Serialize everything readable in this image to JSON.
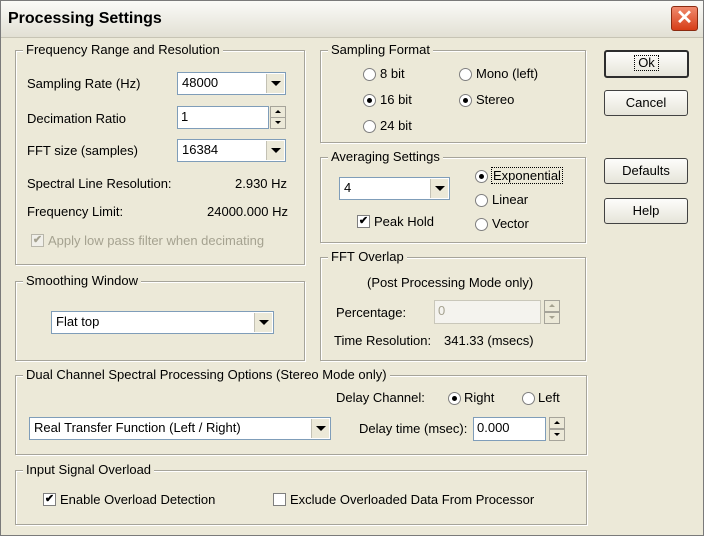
{
  "dialog": {
    "title": "Processing Settings",
    "close_glyph": "✕"
  },
  "freq": {
    "title": "Frequency Range and Resolution",
    "sampling_rate_label": "Sampling Rate (Hz)",
    "sampling_rate_value": "48000",
    "decimation_label": "Decimation Ratio",
    "decimation_value": "1",
    "fft_size_label": "FFT size (samples)",
    "fft_size_value": "16384",
    "spectral_res_label": "Spectral Line Resolution:",
    "spectral_res_value": "2.930 Hz",
    "freq_limit_label": "Frequency Limit:",
    "freq_limit_value": "24000.000 Hz",
    "lowpass_label": "Apply low pass filter when decimating",
    "lowpass_checked": true,
    "lowpass_check_glyph": "✔"
  },
  "sampling": {
    "title": "Sampling Format",
    "bits8": "8 bit",
    "bits16": "16 bit",
    "bits24": "24 bit",
    "mono": "Mono (left)",
    "stereo": "Stereo",
    "selected_bits": "16 bit",
    "selected_channels": "Stereo"
  },
  "averaging": {
    "title": "Averaging Settings",
    "count_value": "4",
    "exponential": "Exponential",
    "linear": "Linear",
    "vector": "Vector",
    "selected": "Exponential",
    "peak_hold_label": "Peak Hold",
    "peak_hold_checked": true,
    "check_glyph": "✔"
  },
  "overlap": {
    "title": "FFT Overlap",
    "note": "(Post Processing Mode only)",
    "percentage_label": "Percentage:",
    "percentage_value": "0",
    "time_res_label": "Time Resolution:",
    "time_res_value": "341.33 (msecs)"
  },
  "smoothing": {
    "title": "Smoothing Window",
    "value": "Flat top"
  },
  "dual": {
    "title": "Dual Channel Spectral Processing Options (Stereo Mode only)",
    "delay_channel_label": "Delay Channel:",
    "right": "Right",
    "left": "Left",
    "selected": "Right",
    "function_value": "Real Transfer Function (Left / Right)",
    "delay_time_label": "Delay time (msec):",
    "delay_time_value": "0.000"
  },
  "overload": {
    "title": "Input Signal Overload",
    "enable_label": "Enable Overload Detection",
    "enable_checked": true,
    "exclude_label": "Exclude Overloaded Data From Processor",
    "exclude_checked": false,
    "check_glyph": "✔"
  },
  "buttons": {
    "ok": "Ok",
    "cancel": "Cancel",
    "defaults": "Defaults",
    "help": "Help"
  }
}
